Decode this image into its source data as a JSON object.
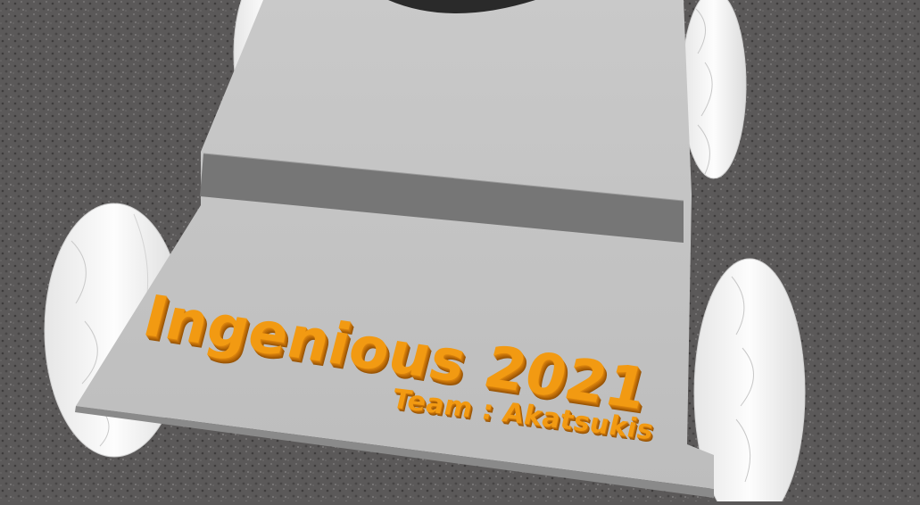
{
  "scene": {
    "title_text": "Ingenious 2021",
    "team_text": "Team : Akatsukis"
  },
  "colors": {
    "ground": "#5a5858",
    "chassis_top": "#c4c4c4",
    "chassis_front": "#7a7a7a",
    "wheel": "#f2f2f2",
    "lettering": "#f29a12"
  }
}
